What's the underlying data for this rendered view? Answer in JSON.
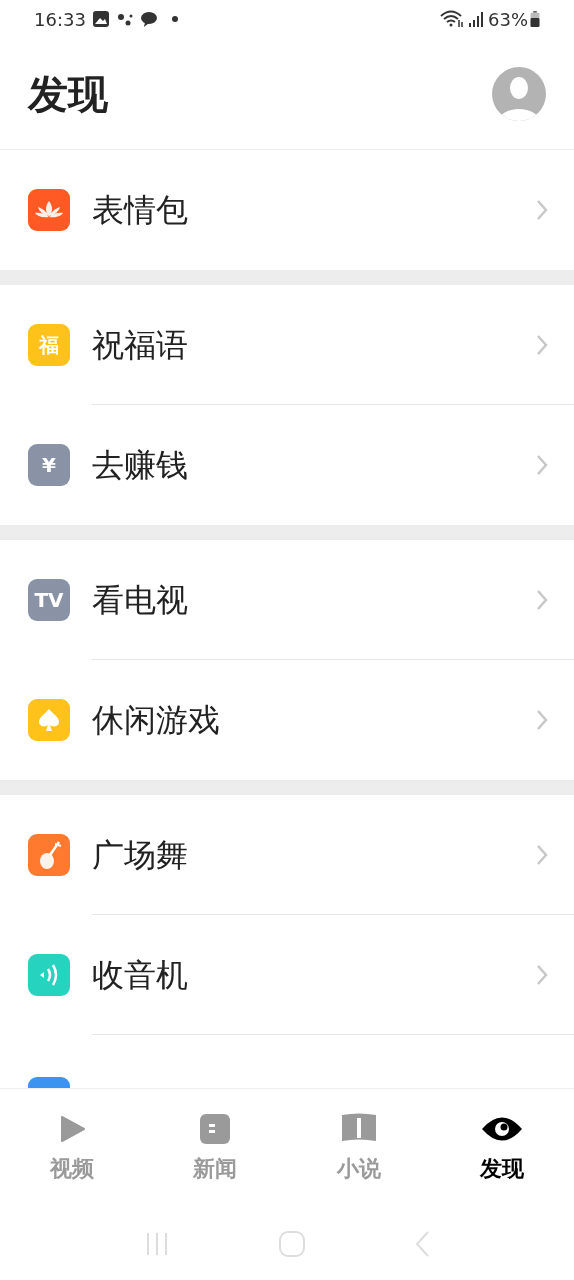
{
  "status_bar": {
    "time": "16:33",
    "battery": "63%"
  },
  "header": {
    "title": "发现"
  },
  "groups": [
    {
      "items": [
        {
          "label": "表情包",
          "kind": "lotus",
          "color": "#ff5a24"
        }
      ]
    },
    {
      "items": [
        {
          "label": "祝福语",
          "kind": "glyph",
          "glyph": "福",
          "color": "#ffc21a"
        },
        {
          "label": "去赚钱",
          "kind": "glyph",
          "glyph": "¥",
          "color": "#8a92a6"
        }
      ]
    },
    {
      "items": [
        {
          "label": "看电视",
          "kind": "glyph",
          "glyph": "TV",
          "color": "#8a92a6"
        },
        {
          "label": "休闲游戏",
          "kind": "spade",
          "color": "#ffc21a"
        }
      ]
    },
    {
      "items": [
        {
          "label": "广场舞",
          "kind": "pipa",
          "color": "#ff7a2e"
        },
        {
          "label": "收音机",
          "kind": "radio",
          "color": "#25d3be"
        }
      ]
    }
  ],
  "tabs": [
    {
      "label": "视频",
      "kind": "play",
      "selected": false
    },
    {
      "label": "新闻",
      "kind": "news",
      "selected": false
    },
    {
      "label": "小说",
      "kind": "book",
      "selected": false
    },
    {
      "label": "发现",
      "kind": "eye",
      "selected": true
    }
  ]
}
